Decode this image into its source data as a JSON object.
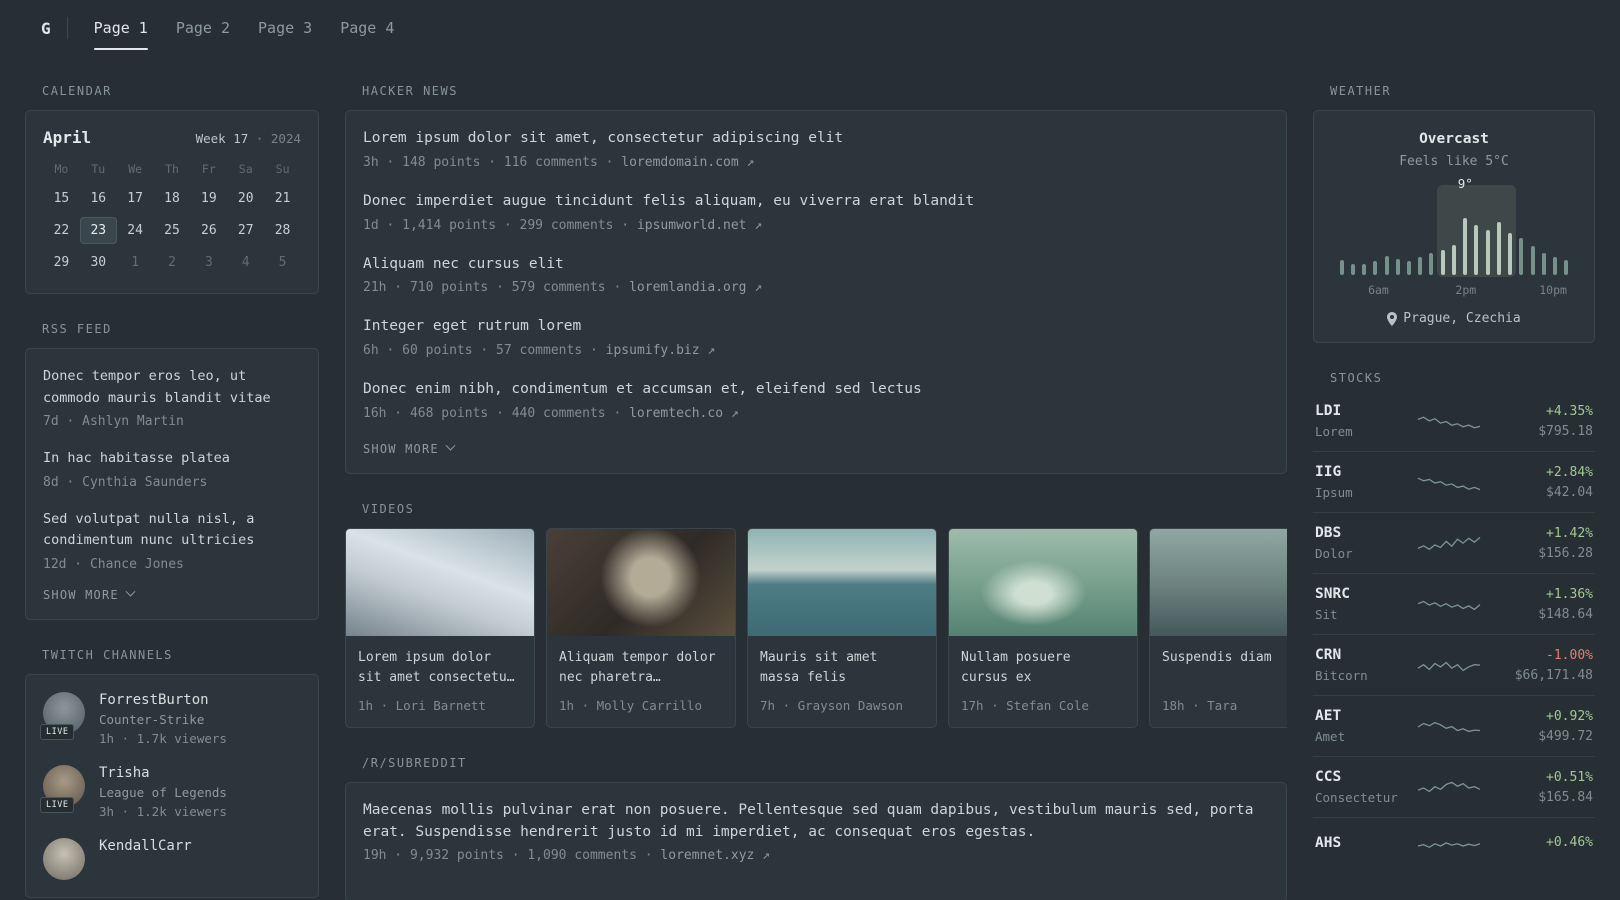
{
  "theme": {
    "positive": "#a3c795",
    "negative": "#e2806e"
  },
  "icons": {
    "external_link": "↗",
    "meta_separator": "·"
  },
  "nav": {
    "logo": "G",
    "pages": [
      {
        "label": "Page 1",
        "active": true
      },
      {
        "label": "Page 2",
        "active": false
      },
      {
        "label": "Page 3",
        "active": false
      },
      {
        "label": "Page 4",
        "active": false
      }
    ]
  },
  "calendar": {
    "title": "CALENDAR",
    "month": "April",
    "week": "Week 17",
    "separator": "·",
    "year": "2024",
    "day_headers": [
      "Mo",
      "Tu",
      "We",
      "Th",
      "Fr",
      "Sa",
      "Su"
    ],
    "days": [
      {
        "d": "15"
      },
      {
        "d": "16"
      },
      {
        "d": "17"
      },
      {
        "d": "18"
      },
      {
        "d": "19"
      },
      {
        "d": "20"
      },
      {
        "d": "21"
      },
      {
        "d": "22"
      },
      {
        "d": "23",
        "selected": true
      },
      {
        "d": "24"
      },
      {
        "d": "25"
      },
      {
        "d": "26"
      },
      {
        "d": "27"
      },
      {
        "d": "28"
      },
      {
        "d": "29"
      },
      {
        "d": "30"
      },
      {
        "d": "1",
        "out": true
      },
      {
        "d": "2",
        "out": true
      },
      {
        "d": "3",
        "out": true
      },
      {
        "d": "4",
        "out": true
      },
      {
        "d": "5",
        "out": true
      }
    ]
  },
  "rss": {
    "title": "RSS FEED",
    "items": [
      {
        "title": "Donec tempor eros leo, ut commodo mauris blandit vitae",
        "meta": "7d · Ashlyn Martin"
      },
      {
        "title": "In hac habitasse platea",
        "meta": "8d · Cynthia Saunders"
      },
      {
        "title": "Sed volutpat nulla nisl, a condimentum nunc ultricies",
        "meta": "12d · Chance Jones"
      }
    ],
    "show_more": "SHOW MORE"
  },
  "twitch": {
    "title": "TWITCH CHANNELS",
    "channels": [
      {
        "name": "ForrestBurton",
        "game": "Counter-Strike",
        "meta": "1h · 1.7k viewers",
        "live": "LIVE"
      },
      {
        "name": "Trisha",
        "game": "League of Legends",
        "meta": "3h · 1.2k viewers",
        "live": "LIVE"
      },
      {
        "name": "KendallCarr"
      }
    ]
  },
  "hackernews": {
    "title": "HACKER NEWS",
    "items": [
      {
        "title": "Lorem ipsum dolor sit amet, consectetur adipiscing elit",
        "meta": "3h · 148 points · 116 comments ·",
        "domain": "loremdomain.com"
      },
      {
        "title": "Donec imperdiet augue tincidunt felis aliquam, eu viverra erat blandit",
        "meta": "1d · 1,414 points · 299 comments ·",
        "domain": "ipsumworld.net"
      },
      {
        "title": "Aliquam nec cursus elit",
        "meta": "21h · 710 points · 579 comments ·",
        "domain": "loremlandia.org"
      },
      {
        "title": "Integer eget rutrum lorem",
        "meta": "6h · 60 points · 57 comments ·",
        "domain": "ipsumify.biz"
      },
      {
        "title": "Donec enim nibh, condimentum et accumsan et, eleifend sed lectus",
        "meta": "16h · 468 points · 440 comments ·",
        "domain": "loremtech.co"
      }
    ],
    "show_more": "SHOW MORE"
  },
  "videos": {
    "title": "VIDEOS",
    "items": [
      {
        "title": "Lorem ipsum dolor sit amet consectetu…",
        "meta": "1h · Lori Barnett",
        "thumbnail": "concrete-cross-sky"
      },
      {
        "title": "Aliquam tempor dolor nec pharetra…",
        "meta": "1h · Molly Carrillo",
        "thumbnail": "hands-holding-camera"
      },
      {
        "title": "Mauris sit amet massa felis",
        "meta": "7h · Grayson Dawson",
        "thumbnail": "boat-wake-sea"
      },
      {
        "title": "Nullam posuere cursus ex",
        "meta": "17h · Stefan Cole",
        "thumbnail": "canoe-fishing"
      },
      {
        "title": "Suspendis diam",
        "meta": "18h · Tara",
        "thumbnail": "foggy-figure"
      }
    ]
  },
  "subreddit": {
    "title": "/R/SUBREDDIT",
    "items": [
      {
        "title": "Maecenas mollis pulvinar erat non posuere. Pellentesque sed quam dapibus, vestibulum mauris sed, porta erat. Suspendisse hendrerit justo id mi imperdiet, ac consequat eros egestas.",
        "meta": "19h · 9,932 points · 1,090 comments ·",
        "domain": "loremnet.xyz"
      }
    ]
  },
  "weather": {
    "title": "WEATHER",
    "condition": "Overcast",
    "feels_like": "Feels like 5°C",
    "current_temp_label": "9°",
    "time_labels": [
      "6am",
      "2pm",
      "10pm"
    ],
    "location": "Prague, Czechia",
    "bars": [
      18,
      13,
      13,
      17,
      23,
      19,
      17,
      21,
      26,
      30,
      36,
      68,
      60,
      54,
      63,
      50,
      44,
      34,
      26,
      22,
      18
    ],
    "highlight": {
      "start": 9,
      "end": 15,
      "label_index": 11
    }
  },
  "stocks": {
    "title": "STOCKS",
    "items": [
      {
        "sym": "LDI",
        "name": "Lorem",
        "change": "+4.35%",
        "price": "$795.18",
        "dir": "up",
        "spark": [
          62,
          72,
          55,
          65,
          45,
          52,
          35,
          42,
          28,
          36,
          24,
          30
        ]
      },
      {
        "sym": "IIG",
        "name": "Ipsum",
        "change": "+2.84%",
        "price": "$42.04",
        "dir": "up",
        "spark": [
          72,
          60,
          66,
          50,
          56,
          40,
          46,
          30,
          36,
          22,
          30,
          20
        ]
      },
      {
        "sym": "DBS",
        "name": "Dolor",
        "change": "+1.42%",
        "price": "$156.28",
        "dir": "up",
        "spark": [
          30,
          42,
          26,
          46,
          34,
          62,
          40,
          72,
          54,
          76,
          58,
          80
        ]
      },
      {
        "sym": "SNRC",
        "name": "Sit",
        "change": "+1.36%",
        "price": "$148.64",
        "dir": "up",
        "spark": [
          56,
          66,
          50,
          60,
          44,
          56,
          40,
          50,
          34,
          46,
          30,
          52
        ]
      },
      {
        "sym": "CRN",
        "name": "Bitcorn",
        "change": "-1.00%",
        "price": "$66,171.48",
        "dir": "down",
        "spark": [
          40,
          56,
          34,
          62,
          46,
          66,
          40,
          56,
          30,
          46,
          56,
          54
        ]
      },
      {
        "sym": "AET",
        "name": "Amet",
        "change": "+0.92%",
        "price": "$499.72",
        "dir": "up",
        "spark": [
          50,
          66,
          56,
          70,
          60,
          44,
          52,
          34,
          42,
          30,
          36,
          34
        ]
      },
      {
        "sym": "CCS",
        "name": "Consectetur",
        "change": "+0.51%",
        "price": "$165.84",
        "dir": "up",
        "spark": [
          40,
          50,
          34,
          56,
          44,
          66,
          76,
          58,
          70,
          50,
          56,
          44
        ]
      },
      {
        "sym": "AHS",
        "change": "+0.46%",
        "dir": "up",
        "spark": [
          50,
          56,
          44,
          60,
          50,
          64,
          54,
          60,
          50,
          58,
          52,
          60
        ]
      }
    ]
  }
}
